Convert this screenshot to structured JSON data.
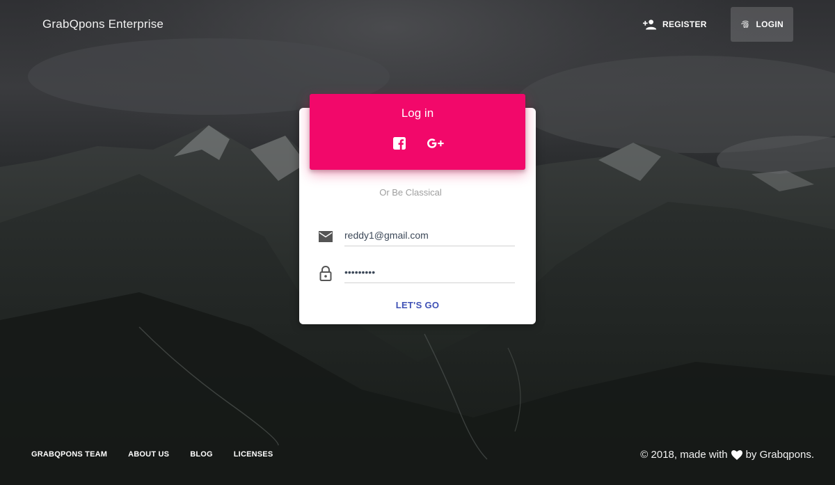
{
  "brand": "GrabQpons Enterprise",
  "nav": {
    "register_label": "REGISTER",
    "login_label": "LOGIN",
    "register_icon": "person-add-icon",
    "login_icon": "fingerprint-icon"
  },
  "card": {
    "title": "Log in",
    "social": [
      "facebook-icon",
      "google-plus-icon"
    ],
    "divider_text": "Or Be Classical",
    "email_value": "reddy1@gmail.com",
    "password_value": "•••••••••",
    "submit_label": "LET'S GO",
    "accent_color": "#f2086a",
    "button_color": "#3f51b5"
  },
  "footer": {
    "links": [
      "GRABQPONS TEAM",
      "ABOUT US",
      "BLOG",
      "LICENSES"
    ],
    "copyright_prefix": "© 2018, made with",
    "copyright_suffix": "by Grabqpons."
  }
}
